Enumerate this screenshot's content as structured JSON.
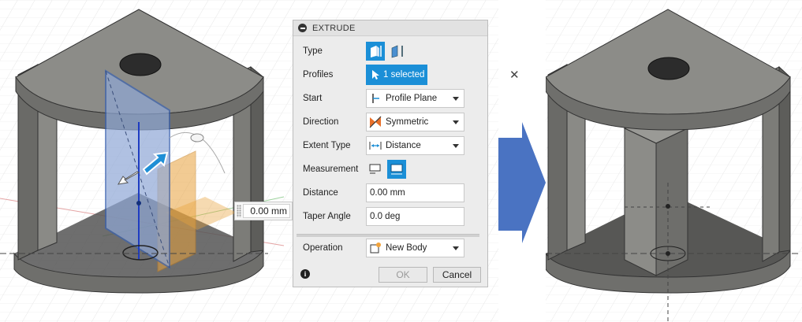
{
  "extrude_panel": {
    "title": "EXTRUDE",
    "type_label": "Type",
    "profiles_label": "Profiles",
    "profiles_value": "1 selected",
    "start_label": "Start",
    "start_value": "Profile Plane",
    "direction_label": "Direction",
    "direction_value": "Symmetric",
    "extent_type_label": "Extent Type",
    "extent_type_value": "Distance",
    "measurement_label": "Measurement",
    "distance_label": "Distance",
    "distance_value": "0.00 mm",
    "taper_angle_label": "Taper Angle",
    "taper_angle_value": "0.0 deg",
    "operation_label": "Operation",
    "operation_value": "New Body",
    "ok_label": "OK",
    "cancel_label": "Cancel"
  },
  "viewport_left": {
    "dimension_value": "0.00 mm"
  },
  "colors": {
    "accent": "#1b8fd7",
    "model_gray": "#7a7a77",
    "profile_plane_blue": "#5b7fb8",
    "preview_orange": "#e8a23c",
    "arrow_blue": "#4a73c2"
  }
}
